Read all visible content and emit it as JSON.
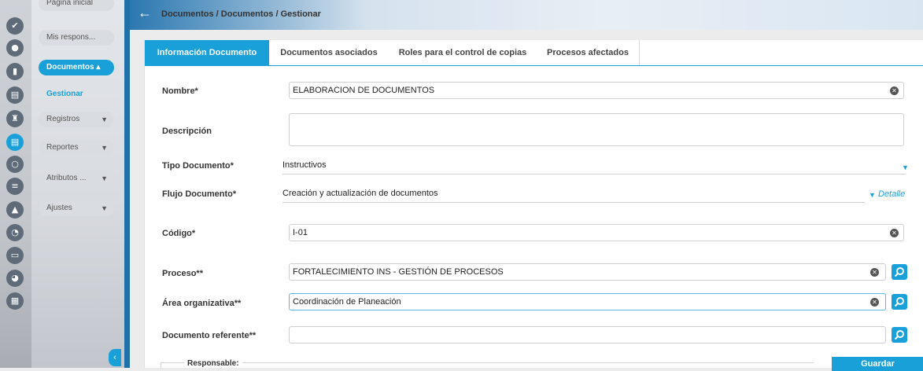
{
  "rail": {
    "icons": [
      "check-circle-icon",
      "user-icon",
      "chart-icon",
      "document-check-icon",
      "tower-icon",
      "document-icon",
      "refresh-icon",
      "sliders-icon",
      "warning-icon",
      "clock-icon",
      "monitor-icon",
      "globe-icon",
      "folder-icon"
    ],
    "active_index": 5
  },
  "submenu": {
    "top_item": "Página inicial",
    "responsabilidades": "Mis respons...",
    "documentos": "Documentos ▴",
    "gestionar": "Gestionar",
    "registros": "Registros",
    "reportes": "Reportes",
    "atributos": "Atributos ...",
    "ajustes": "Ajustes"
  },
  "header": {
    "breadcrumb": "Documentos / Documentos / Gestionar"
  },
  "tabs": [
    "Información Documento",
    "Documentos asociados",
    "Roles para el control de copias",
    "Procesos afectados"
  ],
  "form": {
    "nombre_label": "Nombre*",
    "nombre_value": "ELABORACION DE DOCUMENTOS",
    "descripcion_label": "Descripción",
    "descripcion_value": "",
    "tipo_label": "Tipo Documento*",
    "tipo_value": "Instructivos",
    "flujo_label": "Flujo Documento*",
    "flujo_value": "Creación y actualización de documentos",
    "detalle_link": "Detalle",
    "codigo_label": "Código*",
    "codigo_value": "I-01",
    "proceso_label": "Proceso**",
    "proceso_value": "FORTALECIMIENTO INS - GESTIÓN DE PROCESOS",
    "area_label": "Área organizativa**",
    "area_value": "Coordinación de Planeación",
    "referente_label": "Documento referente**",
    "referente_value": "",
    "responsable_legend": "Responsable:",
    "save_label": "Guardar"
  },
  "colors": {
    "accent": "#1aa0d8",
    "sidebar_dark": "#1f6fa8"
  }
}
